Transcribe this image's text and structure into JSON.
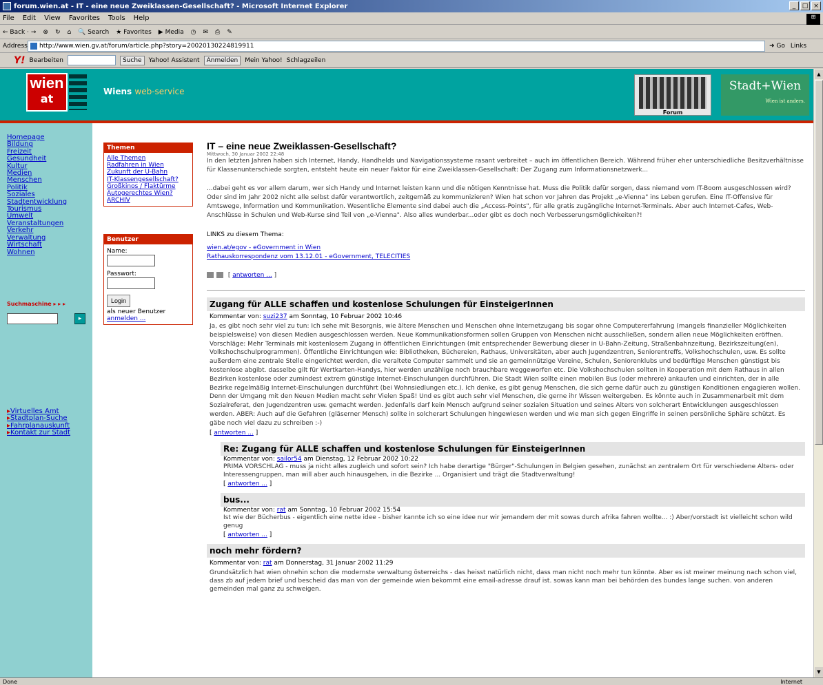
{
  "browser": {
    "title": "forum.wien.at - IT - eine neue Zweiklassen-Gesellschaft? - Microsoft Internet Explorer",
    "menu": [
      "File",
      "Edit",
      "View",
      "Favorites",
      "Tools",
      "Help"
    ],
    "toolbar": [
      "Back",
      "Search",
      "Favorites",
      "Media"
    ],
    "address_label": "Address",
    "address": "http://www.wien.gv.at/forum/article.php?story=20020130224819911",
    "go": "Go",
    "links": "Links",
    "yahoo": {
      "bearbeiten": "Bearbeiten",
      "suche": "Suche",
      "assistent": "Yahoo! Assistent",
      "anmelden": "Anmelden",
      "mein": "Mein Yahoo!",
      "schlagzeilen": "Schlagzeilen"
    },
    "status": "Done",
    "zone": "Internet"
  },
  "header": {
    "logo_top": "wien",
    "logo_bottom": "at",
    "service_a": "Wiens",
    "service_b": "web-service",
    "forum": "Forum",
    "stadt": "Stadt+Wien",
    "stadt_tag": "Wien ist anders."
  },
  "sidebar": {
    "nav": [
      "Homepage",
      "Bildung",
      "Freizeit",
      "Gesundheit",
      "Kultur",
      "Medien",
      "Menschen",
      "Politik",
      "Soziales",
      "Stadtentwicklung",
      "Tourismus",
      "Umwelt",
      "Veranstaltungen",
      "Verkehr",
      "Verwaltung",
      "Wirtschaft",
      "Wohnen"
    ],
    "suche": "Suchmaschine",
    "ext": [
      "Virtuelles Amt",
      "Stadtplan-Suche",
      "Fahrplanauskunft",
      "Kontakt zur Stadt"
    ]
  },
  "themen": {
    "title": "Themen",
    "items": [
      "Alle Themen",
      "Radfahren in Wien",
      "Zukunft der U-Bahn",
      "IT-Klassengesellschaft?",
      "Großkinos / Flaktürme",
      "Autogerechtes Wien?",
      "ARCHIV"
    ]
  },
  "benutzer": {
    "title": "Benutzer",
    "name_label": "Name:",
    "pw_label": "Passwort:",
    "login": "Login",
    "note": "als neuer Benutzer",
    "register": "anmelden ..."
  },
  "article": {
    "title": "IT – eine neue Zweiklassen-Gesellschaft?",
    "date": "Mittwoch, 30 Januar 2002 22:48",
    "p1": "In den letzten Jahren haben sich Internet, Handy, Handhelds und Navigationssysteme rasant verbreitet – auch im öffentlichen Bereich. Während früher eher unterschiedliche Besitzverhältnisse für Klassenunterschiede sorgten, entsteht heute ein neuer Faktor für eine Zweiklassen-Gesellschaft: Der Zugang zum Informationsnetzwerk...",
    "p2": "...dabei geht es vor allem darum, wer sich Handy und Internet leisten kann und die nötigen Kenntnisse hat. Muss die Politik dafür sorgen, dass niemand vom IT-Boom ausgeschlossen wird? Oder sind im Jahr 2002 nicht alle selbst dafür verantwortlich, zeitgemäß zu kommunizieren? Wien hat schon vor Jahren das Projekt „e-Vienna\" ins Leben gerufen. Eine IT-Offensive für Amtswege, Information und Kommunikation. Wesentliche Elemente sind dabei auch die „Access-Points\", für alle gratis zugängliche Internet-Terminals. Aber auch Internet-Cafes, Web-Anschlüsse in Schulen und Web-Kurse sind Teil von „e-Vienna\". Also alles wunderbar...oder gibt es doch noch Verbesserungsmöglichkeiten?!",
    "links_hdr": "LINKS zu diesem Thema:",
    "link1": "wien.at/egov - eGovernment in Wien",
    "link2": "Rathauskorrespondenz vom 13.12.01 - eGovernment, TELECITIES",
    "reply": "antworten ..."
  },
  "comments": [
    {
      "title": "Zugang für ALLE schaffen und kostenlose Schulungen für EinsteigerInnen",
      "meta_a": "Kommentar von:",
      "user": "suzi237",
      "meta_b": "am Sonntag, 10 Februar 2002 10:46",
      "body": "Ja, es gibt noch sehr viel zu tun: Ich sehe mit Besorgnis, wie ältere Menschen und Menschen ohne Internetzugang bis sogar ohne Computererfahrung (mangels finanzieller Möglichkeiten beispielsweise) von diesen Medien ausgeschlossen werden. Neue Kommunikationsformen sollen Gruppen von Menschen nicht ausschließen, sondern allen neue Möglichkeiten eröffnen. Vorschläge: Mehr Terminals mit kostenlosem Zugang in öffentlichen Einrichtungen (mit entsprechender Bewerbung dieser in U-Bahn-Zeitung, Straßenbahnzeitung, Bezirkszeitung(en), Volkshochschulprogrammen). Öffentliche Einrichtungen wie: Bibliotheken, Büchereien, Rathaus, Universitäten, aber auch Jugendzentren, Seniorentreffs, Volkshochschulen, usw. Es sollte außerdem eine zentrale Stelle eingerichtet werden, die veraltete Computer sammelt und sie an gemeinnützige Vereine, Schulen, Seniorenklubs und bedürftige Menschen günstigst bis kostenlose abgibt. dasselbe gilt für Wertkarten-Handys, hier werden unzählige noch brauchbare weggeworfen etc. Die Volkshochschulen sollten in Kooperation mit dem Rathaus in allen Bezirken kostenlose oder zumindest extrem günstige Internet-Einschulungen durchführen. Die Stadt Wien sollte einen mobilen Bus (oder mehrere) ankaufen und einrichten, der in alle Bezirke regelmäßig Internet-Einschulungen durchführt (bei Wohnsiedlungen etc.). Ich denke, es gibt genug Menschen, die sich gerne dafür auch zu günstigen Konditionen engagieren wollen. Denn der Umgang mit den Neuen Medien macht sehr Vielen Spaß! Und es gibt auch sehr viel Menschen, die gerne ihr Wissen weitergeben. Es könnte auch in Zusammenarbeit mit dem Sozialreferat, den Jugendzentren usw. gemacht werden. Jedenfalls darf kein Mensch aufgrund seiner sozialen Situation und seines Alters von solcherart Entwicklungen ausgeschlossen werden. ABER: Auch auf die Gefahren (gläserner Mensch) sollte in solcherart Schulungen hingewiesen werden und wie man sich gegen Eingriffe in seinen persönliche Sphäre schützt. Es gäbe noch viel dazu zu schreiben :-)"
    },
    {
      "title": "Re: Zugang für ALLE schaffen und kostenlose Schulungen für EinsteigerInnen",
      "meta_a": "Kommentar von:",
      "user": "sailor54",
      "meta_b": "am Dienstag, 12 Februar 2002 10:22",
      "body": "PRIMA VORSCHLAG - muss ja nicht alles zugleich und sofort sein? Ich habe derartige \"Bürger\"-Schulungen in Belgien gesehen, zunächst an zentralem Ort für verschiedene Alters- oder Interessengruppen, man will aber auch hinausgehen, in die Bezirke ... Organisiert und trägt die Stadtverwaltung!"
    },
    {
      "title": "bus...",
      "meta_a": "Kommentar von:",
      "user": "rat",
      "meta_b": "am Sonntag, 10 Februar 2002 15:54",
      "body": "Ist wie der Bücherbus - eigentlich eine nette idee - bisher kannte ich so eine idee nur wir jemandem der mit sowas durch afrika fahren wollte... :) Aber/vorstadt ist vielleicht schon wild genug"
    },
    {
      "title": "noch mehr fördern?",
      "meta_a": "Kommentar von:",
      "user": "rat",
      "meta_b": "am Donnerstag, 31 Januar 2002 11:29",
      "body": "Grundsätzlich hat wien ohnehin schon die modernste verwaltung österreichs - das heisst natürlich nicht, dass man nicht noch mehr tun könnte. Aber es ist meiner meinung nach schon viel, dass zb auf jedem brief und bescheid das man von der gemeinde wien bekommt eine email-adresse drauf ist. sowas kann man bei behörden des bundes lange suchen. von anderen gemeinden mal ganz zu schweigen."
    }
  ]
}
